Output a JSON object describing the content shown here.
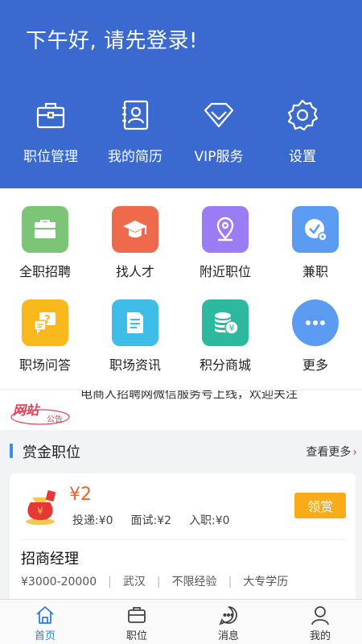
{
  "header": {
    "greeting": "下午好, 请先登录!",
    "quick_actions": [
      {
        "label": "职位管理",
        "icon": "briefcase-icon"
      },
      {
        "label": "我的简历",
        "icon": "resume-icon"
      },
      {
        "label": "VIP服务",
        "icon": "diamond-icon"
      },
      {
        "label": "设置",
        "icon": "gear-icon"
      }
    ]
  },
  "grid": [
    {
      "label": "全职招聘",
      "icon": "briefcase-icon",
      "color": "#7cc576"
    },
    {
      "label": "找人才",
      "icon": "graduation-cap-icon",
      "color": "#ef6a4a"
    },
    {
      "label": "附近职位",
      "icon": "location-pin-icon",
      "color": "#9a7cf4"
    },
    {
      "label": "兼职",
      "icon": "clock-icon",
      "color": "#5b9cf2"
    },
    {
      "label": "职场问答",
      "icon": "qa-bubble-icon",
      "color": "#f9b81c"
    },
    {
      "label": "职场资讯",
      "icon": "document-icon",
      "color": "#3dbde8"
    },
    {
      "label": "积分商城",
      "icon": "coins-icon",
      "color": "#2db9a0"
    },
    {
      "label": "更多",
      "icon": "more-dots-icon",
      "color": "#5b9cf2"
    }
  ],
  "notice": {
    "logo_text": "网站",
    "logo_sub": "公告",
    "text": "电商人招聘网微信服务号上线，欢迎关注"
  },
  "section": {
    "title": "赏金职位",
    "more": "查看更多"
  },
  "job": {
    "reward": "¥2",
    "deliver": "投递:¥0",
    "interview": "面试:¥2",
    "hired": "入职:¥0",
    "claim": "领赏",
    "title": "招商经理",
    "salary": "¥3000-20000",
    "city": "武汉",
    "experience": "不限经验",
    "education": "大专学历"
  },
  "tabs": [
    {
      "label": "首页",
      "icon": "home-icon",
      "active": true
    },
    {
      "label": "职位",
      "icon": "briefcase-icon",
      "active": false
    },
    {
      "label": "消息",
      "icon": "message-icon",
      "active": false
    },
    {
      "label": "我的",
      "icon": "user-icon",
      "active": false
    }
  ],
  "colors": {
    "header_bg": "#3a6ad0",
    "accent": "#2f7ee0",
    "reward": "#e7642a",
    "claim_button": "#f9ab19"
  }
}
